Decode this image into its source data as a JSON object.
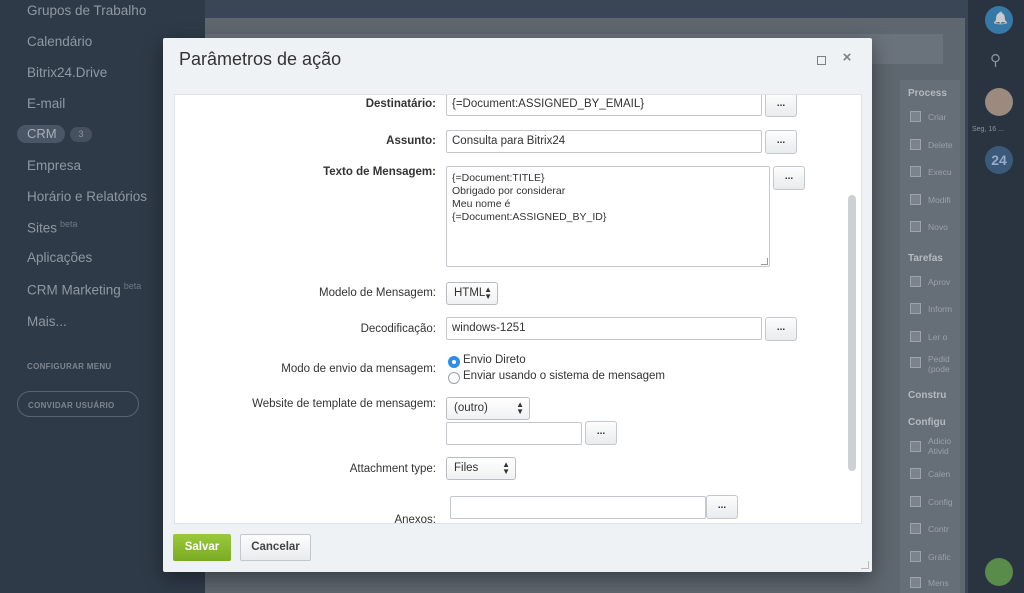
{
  "sidebar": {
    "items": [
      {
        "label": "Grupos de Trabalho"
      },
      {
        "label": "Calendário"
      },
      {
        "label": "Bitrix24.Drive"
      },
      {
        "label": "E-mail"
      },
      {
        "label": "CRM",
        "count": "3"
      },
      {
        "label": "Empresa"
      },
      {
        "label": "Horário e Relatórios"
      },
      {
        "label": "Sites",
        "badge": "beta"
      },
      {
        "label": "Aplicações"
      },
      {
        "label": "CRM Marketing",
        "badge": "beta"
      },
      {
        "label": "Mais..."
      }
    ],
    "configure_menu": "CONFIGURAR MENU",
    "invite_user": "CONVIDAR USUÁRIO"
  },
  "right_panel": {
    "sections": [
      "Process",
      "Tarefas",
      "Constru",
      "Configu"
    ],
    "items": [
      "Criar",
      "Delete",
      "Execu",
      "Modifi",
      "Novo",
      "Aprov",
      "Inform",
      "Ler o",
      "Pedid (pode",
      "Adicio Ativid",
      "Calen",
      "Config",
      "Contr",
      "Gráfic",
      "Mens"
    ]
  },
  "right_rail": {
    "date": "Seg, 16 ...",
    "logo": "24"
  },
  "modal": {
    "title": "Parâmetros de ação",
    "fields": {
      "recipient": {
        "label": "Destinatário:",
        "value": "{=Document:ASSIGNED_BY_EMAIL}"
      },
      "subject": {
        "label": "Assunto:",
        "value": "Consulta para Bitrix24"
      },
      "message_text": {
        "label": "Texto de Mensagem:",
        "lines": [
          "{=Document:TITLE}",
          "Obrigado por considerar",
          "Meu nome é",
          "{=Document:ASSIGNED_BY_ID}"
        ]
      },
      "message_template": {
        "label": "Modelo de Mensagem:",
        "value": "HTML"
      },
      "encoding": {
        "label": "Decodificação:",
        "value": "windows-1251"
      },
      "send_mode": {
        "label": "Modo de envio da mensagem:",
        "options": [
          "Envio Direto",
          "Enviar usando o sistema de mensagem"
        ],
        "selected": "Envio Direto"
      },
      "template_site": {
        "label": "Website de template de mensagem:",
        "value": "(outro)",
        "extra_value": ""
      },
      "attachment_type": {
        "label": "Attachment type:",
        "value": "Files"
      },
      "attachments": {
        "label": "Anexos:",
        "value": ""
      }
    },
    "dots_label": "...",
    "save": "Salvar",
    "cancel": "Cancelar"
  }
}
